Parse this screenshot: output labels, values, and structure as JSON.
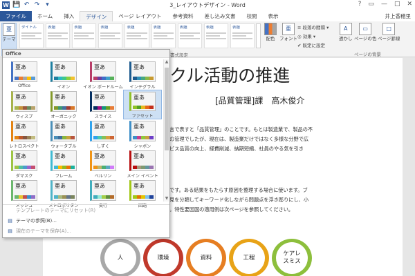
{
  "window": {
    "title": "3_レイアウトデザイン - Word",
    "user": "井上香穂里",
    "controls": [
      "?",
      "▭",
      "—",
      "□",
      "✕"
    ]
  },
  "qat": [
    "W",
    "💾",
    "↶",
    "↷",
    "▾"
  ],
  "tabs": [
    {
      "label": "ファイル",
      "state": "file"
    },
    {
      "label": "ホーム"
    },
    {
      "label": "挿入"
    },
    {
      "label": "デザイン",
      "state": "active"
    },
    {
      "label": "ページ レイアウト"
    },
    {
      "label": "参考資料"
    },
    {
      "label": "差し込み文書"
    },
    {
      "label": "校閲"
    },
    {
      "label": "表示"
    }
  ],
  "ribbon": {
    "theme_label": "テーマ",
    "style_headers": [
      "タイトル",
      "表題",
      "表題",
      "表題",
      "表題",
      "表題",
      "表題",
      "表題",
      "表題"
    ],
    "color_label": "配色",
    "font_label": "フォント",
    "paragraph_spacing": "段落の間隔 ▾",
    "effects": "効果 ▾",
    "set_default": "既定に設定",
    "watermark": "透かし",
    "page_color": "ページの色",
    "page_border": "ページ罫線",
    "group_page_bg": "ページの背景"
  },
  "gallery": {
    "header": "Office",
    "themes": [
      {
        "name": "Office",
        "colors": [
          "#4472c4",
          "#ed7d31",
          "#a5a5a5",
          "#ffc000",
          "#5b9bd5"
        ]
      },
      {
        "name": "イオン",
        "colors": [
          "#1e7fa0",
          "#2fb8c4",
          "#3ec88b",
          "#8ccf3e",
          "#f2c12e"
        ]
      },
      {
        "name": "イオン ボードルーム",
        "colors": [
          "#b83d68",
          "#6b3fa0",
          "#3f6ec8",
          "#3ea0c8",
          "#57b25b"
        ]
      },
      {
        "name": "インテグラル",
        "colors": [
          "#1d5b8f",
          "#2f8fb8",
          "#48a87f",
          "#8ab848",
          "#c89a2f"
        ]
      },
      {
        "name": "ウィスプ",
        "colors": [
          "#a7b34b",
          "#c4913a",
          "#9a5a3c",
          "#6a8c5c",
          "#b8a36c"
        ]
      },
      {
        "name": "オーガニック",
        "colors": [
          "#83992a",
          "#3c9770",
          "#44709d",
          "#a23c33",
          "#d97828"
        ]
      },
      {
        "name": "スライス",
        "colors": [
          "#052f61",
          "#a50e82",
          "#14967c",
          "#6a9e1f",
          "#e87d37"
        ]
      },
      {
        "name": "ファセット",
        "colors": [
          "#90c226",
          "#54a021",
          "#e6b91e",
          "#e76618",
          "#c42f1a"
        ]
      },
      {
        "name": "レトロスペクト",
        "colors": [
          "#e48312",
          "#bd582c",
          "#865640",
          "#9b8357",
          "#c2bc80"
        ]
      },
      {
        "name": "ウォータブル",
        "colors": [
          "#4a8fb8",
          "#3f6e9a",
          "#8ab83e",
          "#c8a23e",
          "#b8553e"
        ]
      },
      {
        "name": "しずく",
        "colors": [
          "#2fa3ee",
          "#4bcaad",
          "#86c157",
          "#d99c3f",
          "#ce6633"
        ]
      },
      {
        "name": "シャボン",
        "colors": [
          "#3e8fc8",
          "#c83e8f",
          "#8fc83e",
          "#c8a23e",
          "#6e3ec8"
        ]
      },
      {
        "name": "ダマスク",
        "colors": [
          "#9ec544",
          "#50bea3",
          "#4a9ccc",
          "#9a66ca",
          "#c54f71"
        ]
      },
      {
        "name": "フレーム",
        "colors": [
          "#40bad2",
          "#fab900",
          "#90bb23",
          "#ee7008",
          "#1ab39f"
        ]
      },
      {
        "name": "ベルリン",
        "colors": [
          "#f09415",
          "#c1b56b",
          "#4baf73",
          "#5aa6c0",
          "#d17df9"
        ]
      },
      {
        "name": "メイン イベント",
        "colors": [
          "#b80e0f",
          "#a6987d",
          "#7f9a71",
          "#64969f",
          "#9b75b2"
        ]
      },
      {
        "name": "メッシュ",
        "colors": [
          "#6bb76d",
          "#e8c231",
          "#c14e4e",
          "#3e8fc8",
          "#8f6ec8"
        ]
      },
      {
        "name": "メトロポリタン",
        "colors": [
          "#50b4c8",
          "#a8b97f",
          "#9b9256",
          "#657689",
          "#7a855d"
        ]
      },
      {
        "name": "奥行",
        "colors": [
          "#41aebd",
          "#97e9d5",
          "#a2cf49",
          "#608f3d",
          "#b36d2a"
        ]
      },
      {
        "name": "回路",
        "colors": [
          "#a2c816",
          "#e07602",
          "#e4c402",
          "#7dc1ef",
          "#21449b"
        ]
      }
    ],
    "selected": "ファセット",
    "cmd_reset": "テンプレートのテーマにリセット(R)",
    "cmd_browse": "テーマの参照(B)...",
    "cmd_save": "現在のテーマを保存(A)..."
  },
  "document": {
    "ruler_label": "書式設定",
    "title": "クル活動の推進",
    "author": "[品質管理]課　高木俊介",
    "para1_lines": [
      "言で表すと「品質管理」のことです。もとは製造業で、製品の不",
      "の管理でしたが、現在は、製造業だけではなく多様な分野で広",
      "ビス品質の向上、経費削減、納期短縮、社員のやる気を引き"
    ],
    "para2_lines": [
      "です。ある結果をもたらす原因を整理する場合に使います。ブ",
      "見を分類してキーワード化しながら問題点を浮き彫りにし、小",
      "。特性要因図の適用例は次ページを参照してください。"
    ],
    "smartart": [
      {
        "label": "人",
        "color": "#a8a8a8"
      },
      {
        "label": "環境",
        "color": "#c0392b"
      },
      {
        "label": "資料",
        "color": "#e67e22"
      },
      {
        "label": "工程",
        "color": "#e8a317"
      },
      {
        "label": "ケアレ\nスミス",
        "color": "#8dbf3c"
      }
    ]
  }
}
